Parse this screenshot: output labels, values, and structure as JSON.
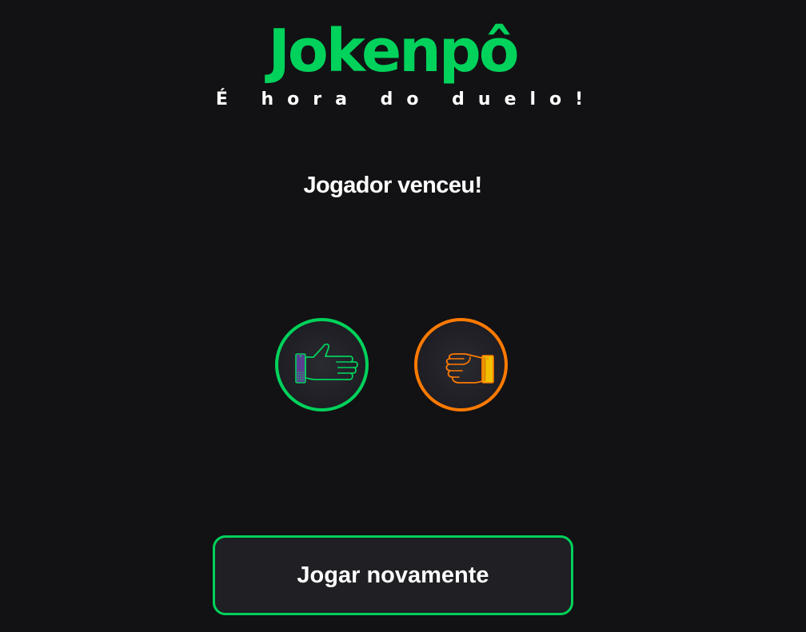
{
  "header": {
    "title": "Jokenpô",
    "subtitle": "É hora do duelo!"
  },
  "game": {
    "result": "Jogador venceu!",
    "player_choice": {
      "icon": "paper-hand-icon",
      "color": "#00d25b"
    },
    "cpu_choice": {
      "icon": "rock-fist-icon",
      "color": "#ff7a00"
    }
  },
  "actions": {
    "play_again_label": "Jogar novamente"
  },
  "colors": {
    "background": "#121214",
    "accent_green": "#00d25b",
    "accent_orange": "#ff7a00",
    "text": "#ffffff"
  }
}
